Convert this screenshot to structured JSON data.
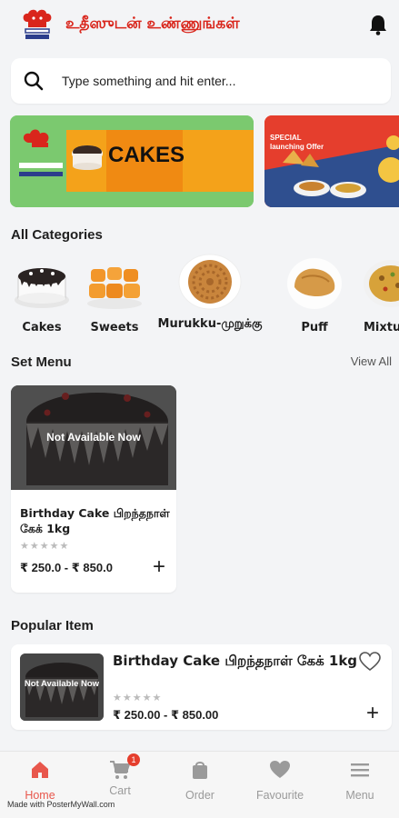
{
  "app": {
    "title": "உதீஸுடன் உண்ணுங்கள்"
  },
  "search": {
    "placeholder": "Type something and hit enter..."
  },
  "banners": [
    {
      "headline": "CAKES"
    },
    {
      "headline": "SPECIAL launching Offer"
    }
  ],
  "categories": {
    "title": "All Categories",
    "items": [
      {
        "label": "Cakes"
      },
      {
        "label": "Sweets"
      },
      {
        "label": "Murukku-முறுக்கு"
      },
      {
        "label": "Puff"
      },
      {
        "label": "Mixture"
      }
    ]
  },
  "set_menu": {
    "title": "Set Menu",
    "view_all": "View All",
    "items": [
      {
        "status": "Not Available Now",
        "name": "Birthday Cake பிறந்தநாள் கேக் 1kg",
        "stars": "★★★★★",
        "price": "₹ 250.0 - ₹ 850.0",
        "add": "+"
      }
    ]
  },
  "popular": {
    "title": "Popular Item",
    "items": [
      {
        "status": "Not Available Now",
        "name": "Birthday Cake பிறந்தநாள் கேக் 1kg",
        "stars": "★★★★★",
        "price": "₹ 250.00 - ₹ 850.00",
        "add": "+"
      }
    ]
  },
  "bottom_nav": {
    "items": [
      {
        "label": "Home",
        "icon": "home-icon",
        "active": true
      },
      {
        "label": "Cart",
        "icon": "cart-icon",
        "badge": "1"
      },
      {
        "label": "Order",
        "icon": "bag-icon"
      },
      {
        "label": "Favourite",
        "icon": "heart-icon"
      },
      {
        "label": "Menu",
        "icon": "hamburger-icon"
      }
    ]
  },
  "watermark": "Made with PosterMyWall.com",
  "colors": {
    "brand": "#d9261c",
    "accent": "#e8574c",
    "muted": "#9a9a9a"
  }
}
